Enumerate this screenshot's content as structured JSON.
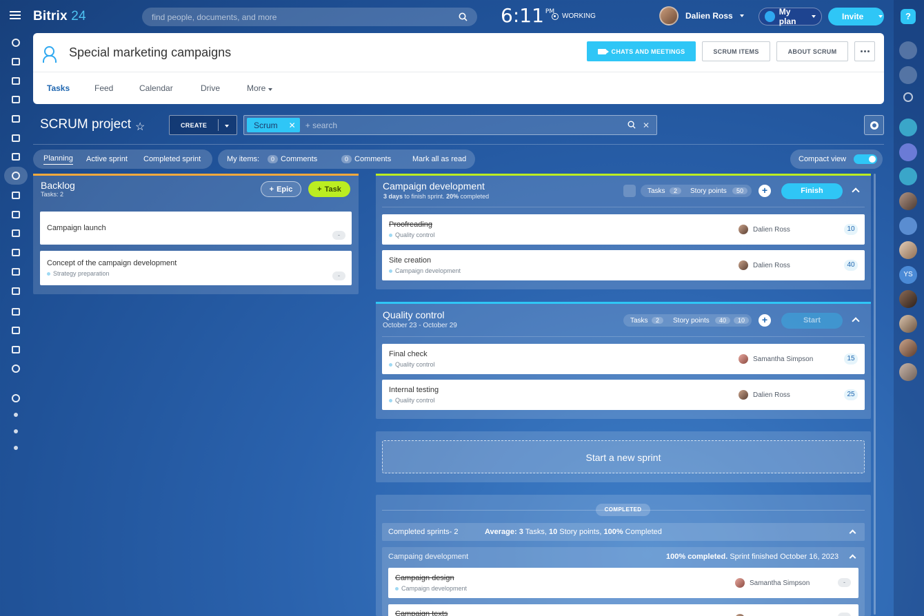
{
  "topbar": {
    "logo_main": "Bitrix",
    "logo_num": "24",
    "search_placeholder": "find people, documents, and more",
    "clock": "6:11",
    "clock_suffix": "PM",
    "status": "WORKING",
    "user_name": "Dalien Ross",
    "plan_label": "My plan",
    "invite_label": "Invite",
    "help_label": "?"
  },
  "header": {
    "title": "Special marketing campaigns",
    "btn_chats": "CHATS AND MEETINGS",
    "btn_scrum_items": "SCRUM ITEMS",
    "btn_about": "ABOUT SCRUM",
    "tabs": [
      "Tasks",
      "Feed",
      "Calendar",
      "Drive",
      "More"
    ]
  },
  "toolbar": {
    "project_title": "SCRUM project",
    "create_label": "CREATE",
    "filter_chip": "Scrum",
    "filter_placeholder": "+ search"
  },
  "viewbar": {
    "tabs": [
      "Planning",
      "Active sprint",
      "Completed sprint"
    ],
    "my_items_label": "My items:",
    "comments_1_count": "0",
    "comments_1_label": "Comments",
    "comments_2_count": "0",
    "comments_2_label": "Comments",
    "mark_read": "Mark all as read",
    "compact_view": "Compact view"
  },
  "backlog": {
    "title": "Backlog",
    "subtitle": "Tasks: 2",
    "epic_label": "Epic",
    "task_label": "Task",
    "items": [
      {
        "title": "Campaign launch",
        "tag": "",
        "points": "-"
      },
      {
        "title": "Concept of the campaign development",
        "tag": "Strategy preparation",
        "points": "-"
      }
    ]
  },
  "sprint_active": {
    "title": "Campaign development",
    "subtitle_bold": "3 days",
    "subtitle_mid": " to finish sprint. ",
    "subtitle_pct": "20%",
    "subtitle_end": " completed",
    "tasks_label": "Tasks",
    "tasks_count": "2",
    "sp_label": "Story points",
    "sp_count": "50",
    "finish_label": "Finish",
    "accent": "#bbed21",
    "items": [
      {
        "title": "Proofreading",
        "tag": "Quality control",
        "assignee": "Dalien Ross",
        "points": "10",
        "done": true
      },
      {
        "title": "Site creation",
        "tag": "Campaign development",
        "assignee": "Dalien Ross",
        "points": "40",
        "done": false
      }
    ]
  },
  "sprint_planned": {
    "title": "Quality control",
    "dates": "October 23 - October 29",
    "tasks_label": "Tasks",
    "tasks_count": "2",
    "sp_label": "Story points",
    "sp_count_a": "40",
    "sp_count_b": "10",
    "start_label": "Start",
    "accent": "#2fc6f6",
    "items": [
      {
        "title": "Final check",
        "tag": "Quality control",
        "assignee": "Samantha Simpson",
        "points": "15"
      },
      {
        "title": "Internal testing",
        "tag": "Quality control",
        "assignee": "Dalien Ross",
        "points": "25"
      }
    ]
  },
  "new_sprint_label": "Start a new sprint",
  "completed": {
    "badge": "COMPLETED",
    "summary_left": "Completed sprints- 2",
    "avg_label": "Average:",
    "avg_tasks_n": "3",
    "avg_tasks": " Tasks, ",
    "avg_sp_n": "10",
    "avg_sp": " Story points, ",
    "avg_pct_n": "100%",
    "avg_pct": " Completed",
    "sprint_name": "Campaing development",
    "sprint_pct": "100% completed.",
    "sprint_finished": " Sprint finished October 16, 2023",
    "items": [
      {
        "title": "Campaign design",
        "tag": "Campaign development",
        "assignee": "Samantha Simpson",
        "points": "-"
      },
      {
        "title": "Campaign texts",
        "tag": "",
        "assignee": "",
        "points": "-"
      }
    ]
  },
  "right_sidebar": {
    "initials": "YS"
  },
  "colors": {
    "accent_blue": "#2fc6f6",
    "accent_green": "#bbed21",
    "backlog_top": "#f7a93c"
  }
}
